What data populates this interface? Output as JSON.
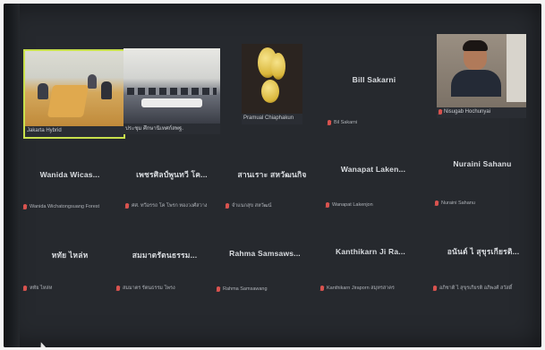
{
  "colors": {
    "background": "#26292e",
    "active_speaker_outline": "#c8e04c",
    "muted_mic": "#d9534f"
  },
  "video_tiles": [
    {
      "caption": "Jakarta Hybrid",
      "scene": "meeting-room-1",
      "active_speaker": true
    },
    {
      "caption": "ประชุม ศึกษานิเทศก์สพฐ.",
      "scene": "meeting-room-2",
      "active_speaker": false
    },
    {
      "caption": "Pramual Chiaphakun",
      "scene": "fruit",
      "active_speaker": false
    },
    {
      "caption": "Nisugab Hochunyai",
      "scene": "person",
      "active_speaker": false
    }
  ],
  "name_tile": {
    "big": "Bill Sakarni",
    "small": "Bil Sakarni"
  },
  "rows": [
    [
      {
        "big": "Wanida Wicas...",
        "small": "Wanida Wichatongsuang Forest"
      },
      {
        "big": "เพชรศิลป์พูนทวี โค...",
        "small": "ศศ. ทวีอรรถ โค โพรก ทองวงศ์สวาง"
      },
      {
        "big": "สานเราะ สหวัฒนกิจ",
        "small": "จำแนกสุข สหวัฒน์"
      },
      {
        "big": "Wanapat Laken...",
        "small": "Wanapat Lakenjon"
      },
      {
        "big": "Nuraini Sahanu",
        "small": "Nuraini Sahanu"
      }
    ],
    [
      {
        "big": "หทัย ไหล่ห",
        "small": "หทัย ไหล่ห"
      },
      {
        "big": "สมมาตรัตนธรรม...",
        "small": "สมมาตร รัตนธรรม โพรง"
      },
      {
        "big": "Rahma Samsaws...",
        "small": "Rahma Samsawang"
      },
      {
        "big": "Kanthikarn Ji Ra...",
        "small": "Kanthikarn Jiraporn สมุทรสาคร"
      },
      {
        "big": "อนันต์ ไ สุขุรเกียรติ...",
        "small": "อภิชาติ ไ สุขุรเกียรติ อภิพงศ์ สวัสดิ์"
      }
    ]
  ]
}
